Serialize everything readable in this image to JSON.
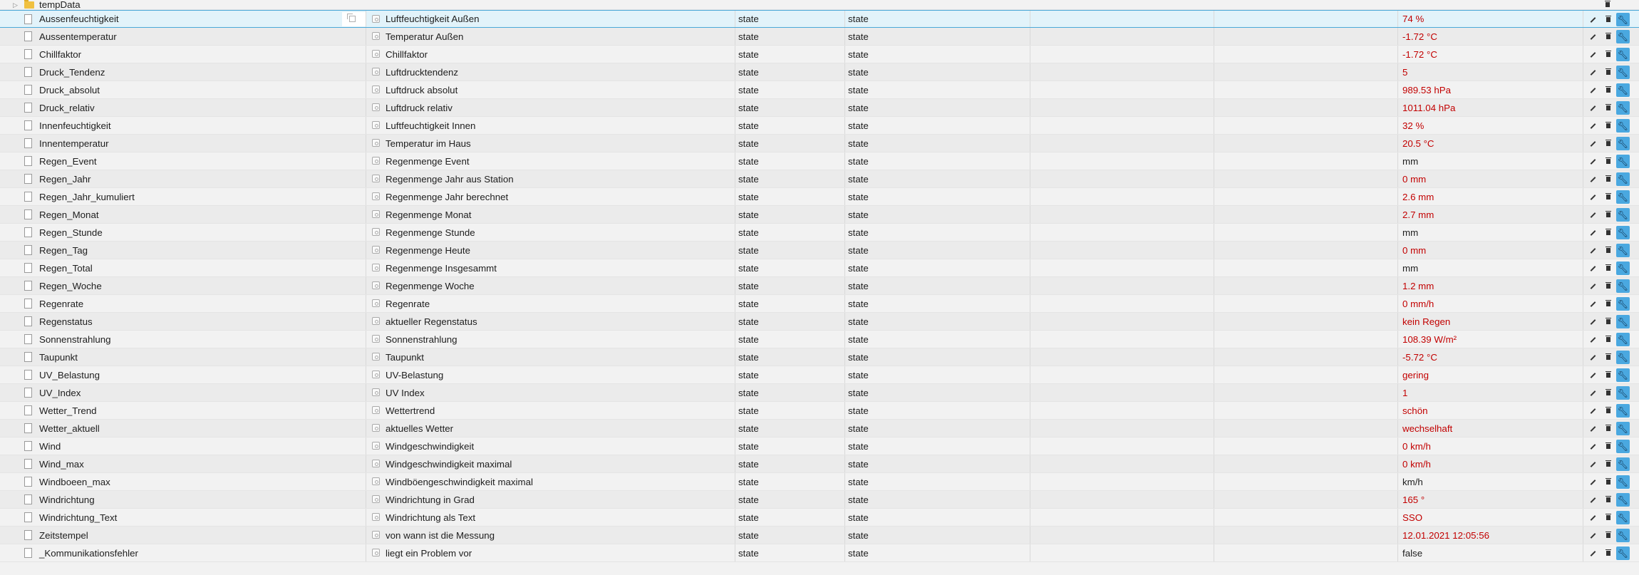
{
  "folder": {
    "name": "tempData"
  },
  "columns": {
    "type_value": "state",
    "role_value": "state"
  },
  "rows": [
    {
      "name": "Aussenfeuchtigkeit",
      "desc": "Luftfeuchtigkeit Außen",
      "type": "state",
      "role": "state",
      "value": "74 %"
    },
    {
      "name": "Aussentemperatur",
      "desc": "Temperatur Außen",
      "type": "state",
      "role": "state",
      "value": "-1.72 °C"
    },
    {
      "name": "Chillfaktor",
      "desc": "Chillfaktor",
      "type": "state",
      "role": "state",
      "value": "-1.72 °C"
    },
    {
      "name": "Druck_Tendenz",
      "desc": "Luftdrucktendenz",
      "type": "state",
      "role": "state",
      "value": "5"
    },
    {
      "name": "Druck_absolut",
      "desc": "Luftdruck absolut",
      "type": "state",
      "role": "state",
      "value": "989.53 hPa"
    },
    {
      "name": "Druck_relativ",
      "desc": "Luftdruck relativ",
      "type": "state",
      "role": "state",
      "value": "1011.04 hPa"
    },
    {
      "name": "Innenfeuchtigkeit",
      "desc": "Luftfeuchtigkeit Innen",
      "type": "state",
      "role": "state",
      "value": "32 %"
    },
    {
      "name": "Innentemperatur",
      "desc": "Temperatur im Haus",
      "type": "state",
      "role": "state",
      "value": "20.5 °C"
    },
    {
      "name": "Regen_Event",
      "desc": "Regenmenge Event",
      "type": "state",
      "role": "state",
      "value": "mm"
    },
    {
      "name": "Regen_Jahr",
      "desc": "Regenmenge Jahr aus Station",
      "type": "state",
      "role": "state",
      "value": "0 mm"
    },
    {
      "name": "Regen_Jahr_kumuliert",
      "desc": "Regenmenge Jahr berechnet",
      "type": "state",
      "role": "state",
      "value": "2.6 mm"
    },
    {
      "name": "Regen_Monat",
      "desc": "Regenmenge Monat",
      "type": "state",
      "role": "state",
      "value": "2.7 mm"
    },
    {
      "name": "Regen_Stunde",
      "desc": "Regenmenge Stunde",
      "type": "state",
      "role": "state",
      "value": "mm"
    },
    {
      "name": "Regen_Tag",
      "desc": "Regenmenge Heute",
      "type": "state",
      "role": "state",
      "value": "0 mm"
    },
    {
      "name": "Regen_Total",
      "desc": "Regenmenge Insgesammt",
      "type": "state",
      "role": "state",
      "value": "mm"
    },
    {
      "name": "Regen_Woche",
      "desc": "Regenmenge Woche",
      "type": "state",
      "role": "state",
      "value": "1.2 mm"
    },
    {
      "name": "Regenrate",
      "desc": "Regenrate",
      "type": "state",
      "role": "state",
      "value": "0 mm/h"
    },
    {
      "name": "Regenstatus",
      "desc": "aktueller Regenstatus",
      "type": "state",
      "role": "state",
      "value": "kein Regen"
    },
    {
      "name": "Sonnenstrahlung",
      "desc": "Sonnenstrahlung",
      "type": "state",
      "role": "state",
      "value": "108.39 W/m²"
    },
    {
      "name": "Taupunkt",
      "desc": "Taupunkt",
      "type": "state",
      "role": "state",
      "value": "-5.72 °C"
    },
    {
      "name": "UV_Belastung",
      "desc": "UV-Belastung",
      "type": "state",
      "role": "state",
      "value": "gering"
    },
    {
      "name": "UV_Index",
      "desc": "UV Index",
      "type": "state",
      "role": "state",
      "value": "1"
    },
    {
      "name": "Wetter_Trend",
      "desc": "Wettertrend",
      "type": "state",
      "role": "state",
      "value": "schön"
    },
    {
      "name": "Wetter_aktuell",
      "desc": "aktuelles Wetter",
      "type": "state",
      "role": "state",
      "value": "wechselhaft"
    },
    {
      "name": "Wind",
      "desc": "Windgeschwindigkeit",
      "type": "state",
      "role": "state",
      "value": "0 km/h"
    },
    {
      "name": "Wind_max",
      "desc": "Windgeschwindigkeit maximal",
      "type": "state",
      "role": "state",
      "value": "0 km/h"
    },
    {
      "name": "Windboeen_max",
      "desc": "Windböengeschwindigkeit maximal",
      "type": "state",
      "role": "state",
      "value": "km/h"
    },
    {
      "name": "Windrichtung",
      "desc": "Windrichtung in Grad",
      "type": "state",
      "role": "state",
      "value": "165 °"
    },
    {
      "name": "Windrichtung_Text",
      "desc": "Windrichtung als Text",
      "type": "state",
      "role": "state",
      "value": "SSO"
    },
    {
      "name": "Zeitstempel",
      "desc": "von wann ist die Messung",
      "type": "state",
      "role": "state",
      "value": "12.01.2021 12:05:56"
    },
    {
      "name": "_Kommunikationsfehler",
      "desc": "liegt ein Problem vor",
      "type": "state",
      "role": "state",
      "value": "false"
    }
  ],
  "colors": {
    "value_red": "#c20000",
    "value_plain": "#202020",
    "selected_bg": "#e2f3fa",
    "accent_blue": "#4aa8e0"
  },
  "icons": {
    "row": "file-icon",
    "desc": "state-icon",
    "edit": "pencil-icon",
    "delete": "trash-icon",
    "config": "wrench-icon",
    "folder": "folder-icon",
    "copy": "copy-icon"
  }
}
